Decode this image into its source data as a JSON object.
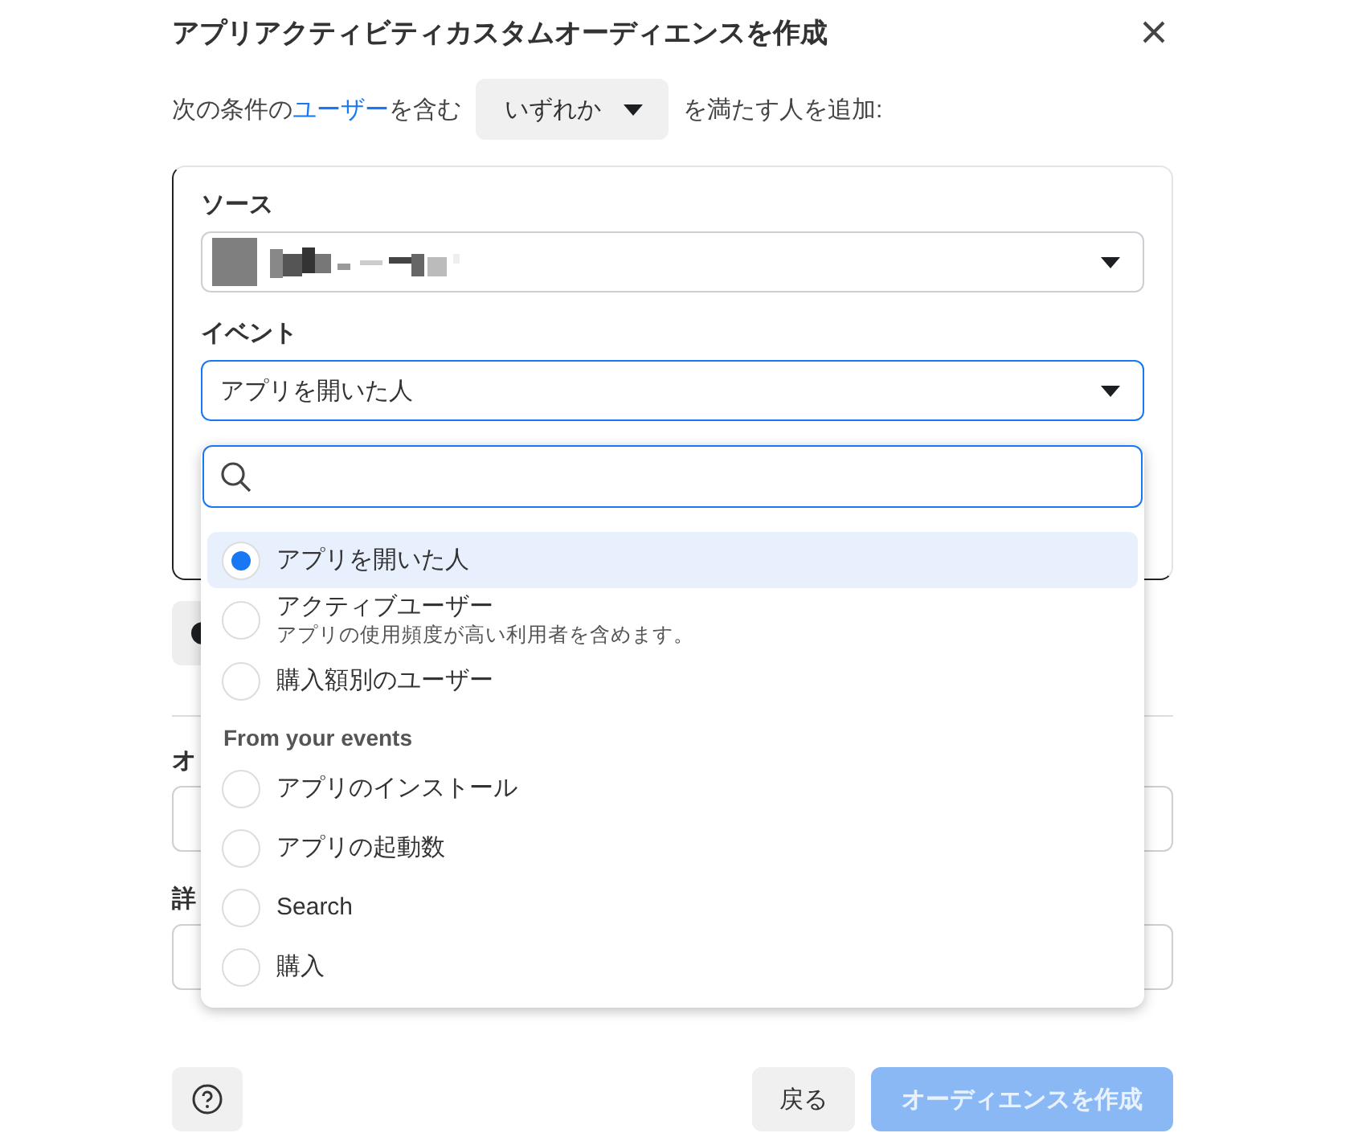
{
  "dialog": {
    "title": "アプリアクティビティカスタムオーディエンスを作成"
  },
  "condition": {
    "prefix": "次の条件の",
    "link": "ユーザー",
    "middle": "を含む",
    "match": "いずれか",
    "suffix": "を満たす人を追加:"
  },
  "card": {
    "source_label": "ソース",
    "event_label": "イベント",
    "event_value": "アプリを開いた人"
  },
  "event_menu": {
    "items": [
      {
        "kind": "option",
        "label": "アプリを開いた人",
        "selected": true
      },
      {
        "kind": "option",
        "label": "アクティブユーザー",
        "description": "アプリの使用頻度が高い利用者を含めます。",
        "selected": false
      },
      {
        "kind": "option",
        "label": "購入額別のユーザー",
        "selected": false
      },
      {
        "kind": "header",
        "label": "From your events"
      },
      {
        "kind": "option",
        "label": "アプリのインストール",
        "selected": false
      },
      {
        "kind": "option",
        "label": "アプリの起動数",
        "selected": false
      },
      {
        "kind": "option",
        "label": "Search",
        "selected": false
      },
      {
        "kind": "option",
        "label": "購入",
        "selected": false
      }
    ]
  },
  "hidden_fields": [
    {
      "label": "オ"
    },
    {
      "label": "詳"
    }
  ],
  "footer": {
    "back": "戻る",
    "create": "オーディエンスを作成",
    "create_disabled": true
  }
}
